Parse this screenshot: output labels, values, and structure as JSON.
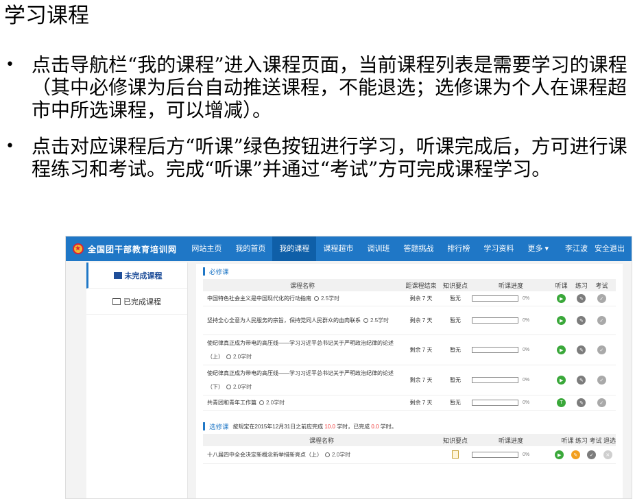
{
  "slide": {
    "title": "学习课程",
    "bullets": [
      "点击导航栏“我的课程”进入课程页面，当前课程列表是需要学习的课程（其中必修课为后台自动推送课程，不能退选；选修课为个人在课程超市中所选课程，可以增减）。",
      "点击对应课程后方“听课”绿色按钮进行学习，听课完成后，方可进行课程练习和考试。完成“听课”并通过“考试”方可完成课程学习。"
    ]
  },
  "nav": {
    "logo": "全国团干部教育培训网",
    "items": [
      "网站主页",
      "我的首页",
      "我的课程",
      "课程超市",
      "调训班",
      "答题挑战",
      "排行榜",
      "学习资料",
      "更多 ▾"
    ],
    "active": "我的课程",
    "user": "李江波",
    "logout": "安全退出"
  },
  "sidebar": {
    "items": [
      {
        "label": "未完成课程"
      },
      {
        "label": "已完成课程"
      }
    ]
  },
  "required": {
    "title": "必修课",
    "headers": {
      "name": "课程名称",
      "left": "距课程结束",
      "know": "知识要点",
      "prog": "听课进度",
      "listen": "听课",
      "practice": "练习",
      "exam": "考试"
    },
    "rows": [
      {
        "name": "中国特色社会主义是中国现代化的行动指南",
        "hours": "2.5学时",
        "left": "剩余 7 天",
        "know": "暂无",
        "pct": "0%"
      },
      {
        "name": "坚持全心全意为人民服务的宗旨，保持党同人民群众的血肉联系",
        "hours": "2.5学时",
        "left": "剩余 7 天",
        "know": "暂无",
        "pct": "0%"
      },
      {
        "name": "使纪律真正成为带电的高压线——学习习近平总书记关于严明政治纪律的论述（上）",
        "hours": "2.0学时",
        "left": "剩余 7 天",
        "know": "暂无",
        "pct": "0%"
      },
      {
        "name": "使纪律真正成为带电的高压线——学习习近平总书记关于严明政治纪律的论述（下）",
        "hours": "2.0学时",
        "left": "剩余 7 天",
        "know": "暂无",
        "pct": "0%"
      },
      {
        "name": "共青团和青年工作篇",
        "hours": "2.0学时",
        "left": "剩余 7 天",
        "know": "暂无",
        "pct": "0%"
      }
    ]
  },
  "elective": {
    "title": "选修课",
    "note_pre": "按规定在2015年12月31日之前应完成",
    "required_hours": "10.0",
    "note_mid": "学时，已完成",
    "done_hours": "0.0",
    "note_post": "学时。",
    "headers": {
      "name": "课程名称",
      "know": "知识要点",
      "prog": "听课进度",
      "actions": "听课 练习 考试 退选"
    },
    "rows": [
      {
        "name": "十八届四中全会决定新概念新举措新亮点（上）",
        "hours": "2.0学时",
        "pct": "0%"
      }
    ]
  },
  "icons": {
    "play": "▶",
    "edit": "✎",
    "exam": "✓",
    "close": "✕",
    "t": "T"
  },
  "colors": {
    "nav": "#1f77c6",
    "green": "#3aa83a",
    "orange": "#f29f1f",
    "red": "#e33333"
  }
}
